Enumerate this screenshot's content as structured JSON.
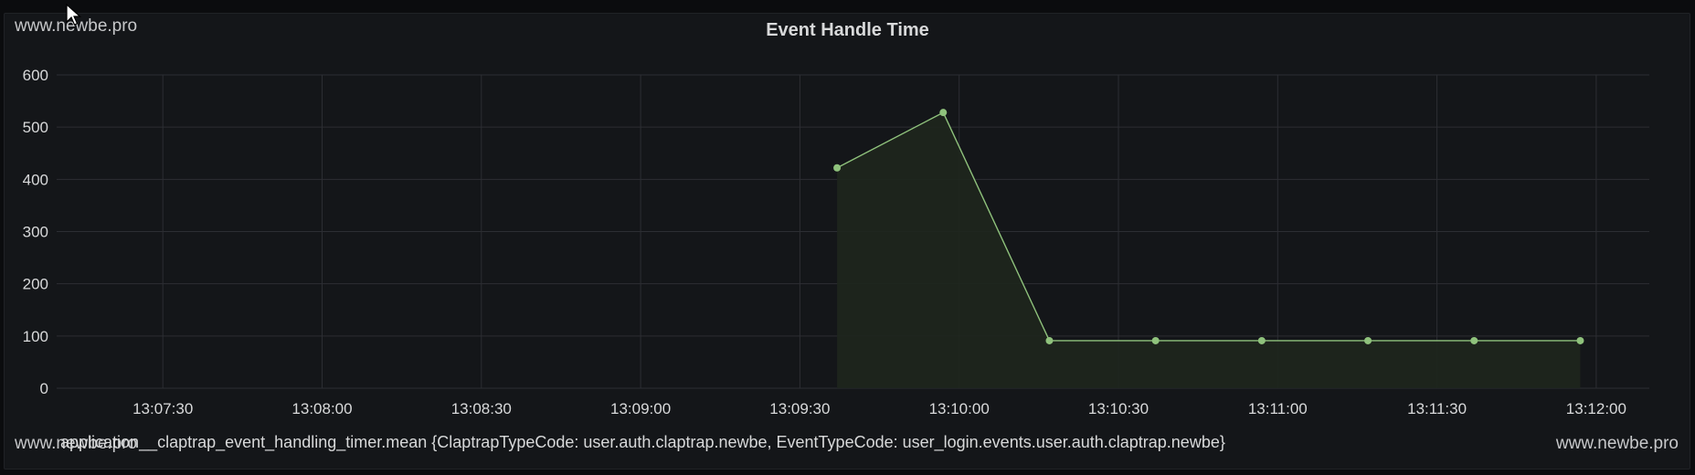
{
  "panel": {
    "title": "Event Handle Time",
    "watermark": "www.newbe.pro"
  },
  "colors": {
    "background": "#141619",
    "grid": "#2c2e33",
    "series": "#8fc27c",
    "fill": "#1e261d"
  },
  "chart_data": {
    "type": "area",
    "title": "Event Handle Time",
    "xlabel": "",
    "ylabel": "",
    "xlim": [
      "13:07:10",
      "13:12:10"
    ],
    "ylim": [
      0,
      600
    ],
    "x_ticks": [
      "13:07:30",
      "13:08:00",
      "13:08:30",
      "13:09:00",
      "13:09:30",
      "13:10:00",
      "13:10:30",
      "13:11:00",
      "13:11:30",
      "13:12:00"
    ],
    "y_ticks": [
      0,
      100,
      200,
      300,
      400,
      500,
      600
    ],
    "grid": true,
    "legend_position": "bottom-left",
    "series": [
      {
        "name": "application__claptrap_event_handling_timer.mean {ClaptrapTypeCode: user.auth.claptrap.newbe, EventTypeCode: user_login.events.user.auth.claptrap.newbe}",
        "x": [
          "13:09:37",
          "13:09:57",
          "13:10:17",
          "13:10:37",
          "13:10:57",
          "13:11:17",
          "13:11:37",
          "13:11:57"
        ],
        "values": [
          422,
          528,
          91,
          91,
          91,
          91,
          91,
          91
        ]
      }
    ]
  }
}
